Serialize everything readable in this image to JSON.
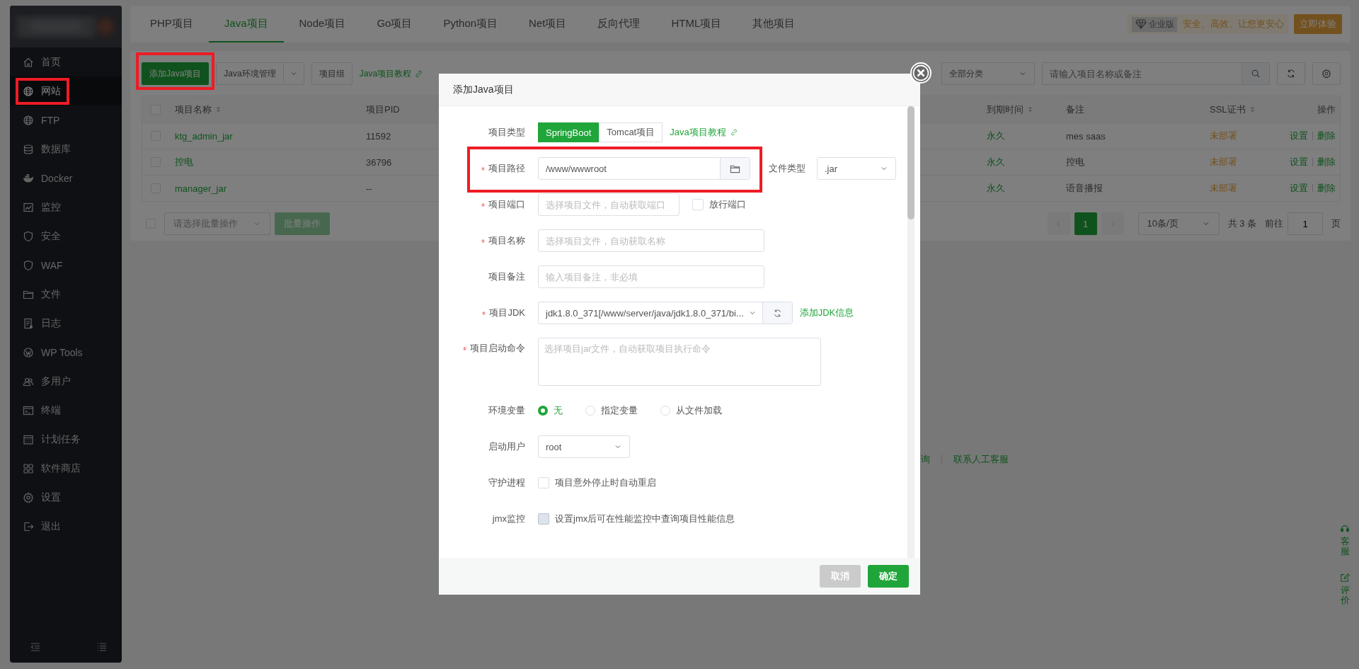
{
  "sidebar": {
    "items": [
      {
        "label": "首页",
        "selected": false,
        "highlighted": false
      },
      {
        "label": "网站",
        "selected": true,
        "highlighted": true
      },
      {
        "label": "FTP",
        "selected": false,
        "highlighted": false
      },
      {
        "label": "数据库",
        "selected": false,
        "highlighted": false
      },
      {
        "label": "Docker",
        "selected": false,
        "highlighted": false
      },
      {
        "label": "监控",
        "selected": false,
        "highlighted": false
      },
      {
        "label": "安全",
        "selected": false,
        "highlighted": false
      },
      {
        "label": "WAF",
        "selected": false,
        "highlighted": false
      },
      {
        "label": "文件",
        "selected": false,
        "highlighted": false
      },
      {
        "label": "日志",
        "selected": false,
        "highlighted": false
      },
      {
        "label": "WP Tools",
        "selected": false,
        "highlighted": false
      },
      {
        "label": "多用户",
        "selected": false,
        "highlighted": false
      },
      {
        "label": "终端",
        "selected": false,
        "highlighted": false
      },
      {
        "label": "计划任务",
        "selected": false,
        "highlighted": false
      },
      {
        "label": "软件商店",
        "selected": false,
        "highlighted": false
      },
      {
        "label": "设置",
        "selected": false,
        "highlighted": false
      },
      {
        "label": "退出",
        "selected": false,
        "highlighted": false
      }
    ]
  },
  "tabs": [
    {
      "label": "PHP项目",
      "selected": false
    },
    {
      "label": "Java项目",
      "selected": true
    },
    {
      "label": "Node项目",
      "selected": false
    },
    {
      "label": "Go项目",
      "selected": false
    },
    {
      "label": "Python项目",
      "selected": false
    },
    {
      "label": "Net项目",
      "selected": false
    },
    {
      "label": "反向代理",
      "selected": false
    },
    {
      "label": "HTML项目",
      "selected": false
    },
    {
      "label": "其他项目",
      "selected": false
    }
  ],
  "promo": {
    "edition": "企业版",
    "slogan": "安全、高效、让您更安心",
    "button": "立即体验"
  },
  "toolbar": {
    "add_button": {
      "label": "添加Java项目",
      "highlighted": true
    },
    "env_button": "Java环境管理",
    "group_button": "项目组",
    "tutorial_link": "Java项目教程",
    "category": "全部分类",
    "search": {
      "placeholder": "请输入项目名称或备注"
    }
  },
  "table": {
    "all_checked": false,
    "columns": [
      {
        "label": "项目名称",
        "sortable": true
      },
      {
        "label": "项目PID",
        "sortable": false
      },
      {
        "label": "到期时间",
        "sortable": true
      },
      {
        "label": "备注",
        "sortable": false
      },
      {
        "label": "SSL证书",
        "sortable": true
      },
      {
        "label": "操作",
        "sortable": false
      }
    ],
    "rows": [
      {
        "checked": false,
        "name": "ktg_admin_jar",
        "pid": "11592",
        "expiry": "永久",
        "note": "mes saas",
        "ssl": "未部署",
        "actions": [
          "设置",
          "删除"
        ]
      },
      {
        "checked": false,
        "name": "控电",
        "pid": "36796",
        "expiry": "永久",
        "note": "控电",
        "ssl": "未部署",
        "actions": [
          "设置",
          "删除"
        ]
      },
      {
        "checked": false,
        "name": "manager_jar",
        "pid": "--",
        "expiry": "永久",
        "note": "语音播报",
        "ssl": "未部署",
        "actions": [
          "设置",
          "删除"
        ]
      }
    ]
  },
  "batch": {
    "checked": false,
    "placeholder": "请选择批量操作",
    "button": "批量操作"
  },
  "pagination": {
    "pages": [
      {
        "label": "1",
        "selected": true
      }
    ],
    "page_size": "10条/页",
    "total": "共 3 条",
    "goto_label": "前往",
    "goto_value": "1",
    "page_unit": "页"
  },
  "footer_links": [
    "询",
    "联系人工客服"
  ],
  "float_widget": [
    "客服",
    "评价"
  ],
  "modal": {
    "title": "添加Java项目",
    "fields": [
      {
        "kind": "segmented",
        "label": "项目类型",
        "required": false,
        "options": [
          {
            "label": "SpringBoot",
            "selected": true
          },
          {
            "label": "Tomcat项目",
            "selected": false
          }
        ],
        "link": "Java项目教程"
      },
      {
        "kind": "path",
        "label": "项目路径",
        "required": true,
        "value": "/www/wwwroot",
        "highlighted": true,
        "side_label": "文件类型",
        "side_value": ".jar"
      },
      {
        "kind": "port",
        "label": "项目端口",
        "required": true,
        "placeholder": "选择项目文件，自动获取端口",
        "option": "放行端口",
        "checked": false
      },
      {
        "kind": "text",
        "label": "项目名称",
        "required": true,
        "placeholder": "选择项目文件，自动获取名称"
      },
      {
        "kind": "text",
        "label": "项目备注",
        "required": false,
        "placeholder": "输入项目备注，非必填"
      },
      {
        "kind": "jdk",
        "label": "项目JDK",
        "required": true,
        "value": "jdk1.8.0_371[/www/server/java/jdk1.8.0_371/bi...",
        "link": "添加JDK信息"
      },
      {
        "kind": "textarea",
        "label": "项目启动命令",
        "required": true,
        "placeholder": "选择项目jar文件，自动获取项目执行命令"
      },
      {
        "kind": "radio",
        "label": "环境变量",
        "required": false,
        "options": [
          {
            "label": "无",
            "selected": true
          },
          {
            "label": "指定变量",
            "selected": false
          },
          {
            "label": "从文件加载",
            "selected": false
          }
        ]
      },
      {
        "kind": "select",
        "label": "启动用户",
        "required": false,
        "value": "root"
      },
      {
        "kind": "checkbox",
        "label": "守护进程",
        "required": false,
        "text": "项目意外停止时自动重启",
        "checked": false,
        "disabled": false
      },
      {
        "kind": "checkbox",
        "label": "jmx监控",
        "required": false,
        "text": "设置jmx后可在性能监控中查询项目性能信息",
        "checked": false,
        "disabled": true
      }
    ],
    "buttons": [
      {
        "label": "取消",
        "kind": "secondary"
      },
      {
        "label": "确定",
        "kind": "primary"
      }
    ]
  }
}
